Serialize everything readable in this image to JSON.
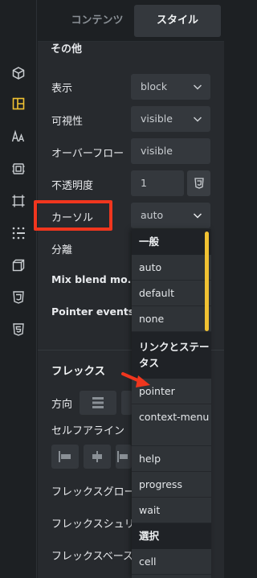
{
  "tabs": {
    "content": "コンテンツ",
    "style": "スタイル"
  },
  "rail_icons": [
    "cube-icon",
    "layout-icon",
    "typography-icon",
    "box-model-icon",
    "frame-icon",
    "grid-dots-icon",
    "cube-outline-icon",
    "css3-icon",
    "html5-icon"
  ],
  "section_other": {
    "title": "その他"
  },
  "rows": {
    "display": {
      "label": "表示",
      "value": "block"
    },
    "visibility": {
      "label": "可視性",
      "value": "visible"
    },
    "overflow": {
      "label": "オーバーフロー",
      "value": "visible"
    },
    "opacity": {
      "label": "不透明度",
      "value": "1"
    },
    "cursor": {
      "label": "カーソル",
      "value": "auto"
    },
    "isolation": {
      "label": "分離"
    },
    "blend": {
      "label": "Mix blend mo..."
    },
    "pointer": {
      "label": "Pointer events"
    }
  },
  "flex": {
    "title": "フレックス",
    "direction_label": "方向",
    "self_align_label": "セルフアライン",
    "grow_label": "フレックスグロー",
    "shrink_label": "フレックスシュリ",
    "basis_label": "フレックスベース"
  },
  "dropdown": {
    "group_general": "一般",
    "general_items": [
      "auto",
      "default",
      "none"
    ],
    "group_link": "リンクとステータス",
    "link_items": [
      "pointer",
      "context-menu",
      "help",
      "progress",
      "wait"
    ],
    "group_select": "選択",
    "select_items": [
      "cell"
    ]
  },
  "colors": {
    "highlight": "#f0361e",
    "scrollbar": "#f1c232"
  }
}
